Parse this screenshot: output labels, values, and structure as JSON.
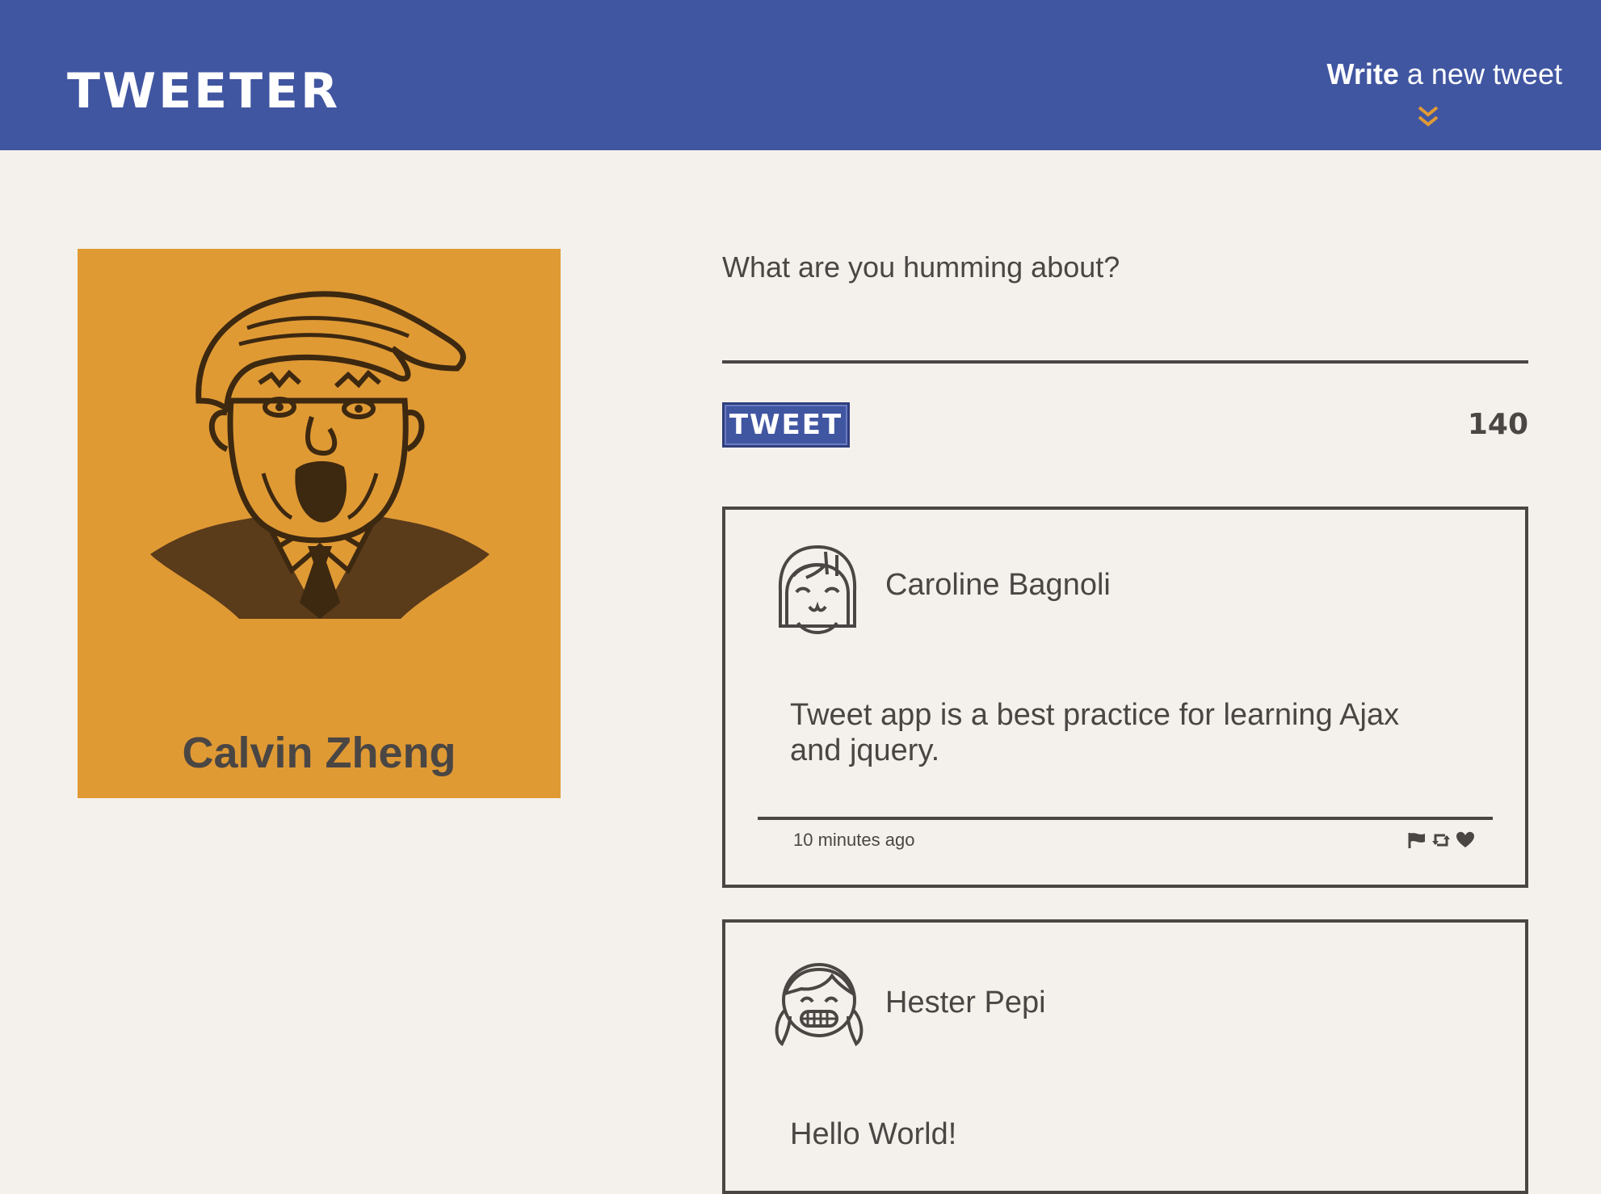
{
  "header": {
    "brand": "TWEETER",
    "compose_toggle": {
      "strong": "Write",
      "rest": " a new tweet",
      "icon": "chevron-double-down-icon"
    },
    "colors": {
      "bar": "#4156a1",
      "accent": "#e09a34"
    }
  },
  "profile": {
    "name": "Calvin Zheng",
    "avatar": "caricature-avatar",
    "card_color": "#e09a34"
  },
  "composer": {
    "placeholder": "What are you humming about?",
    "value": "",
    "submit_label": "TWEET",
    "char_counter": "140"
  },
  "tweets": [
    {
      "author": "Caroline Bagnoli",
      "avatar": "smiling-girl-avatar",
      "text": "Tweet app is a best practice for learning Ajax and jquery.",
      "timestamp": "10 minutes ago",
      "actions": [
        "flag-icon",
        "retweet-icon",
        "heart-icon"
      ]
    },
    {
      "author": "Hester Pepi",
      "avatar": "grinning-girl-avatar",
      "text": "Hello World!"
    }
  ]
}
